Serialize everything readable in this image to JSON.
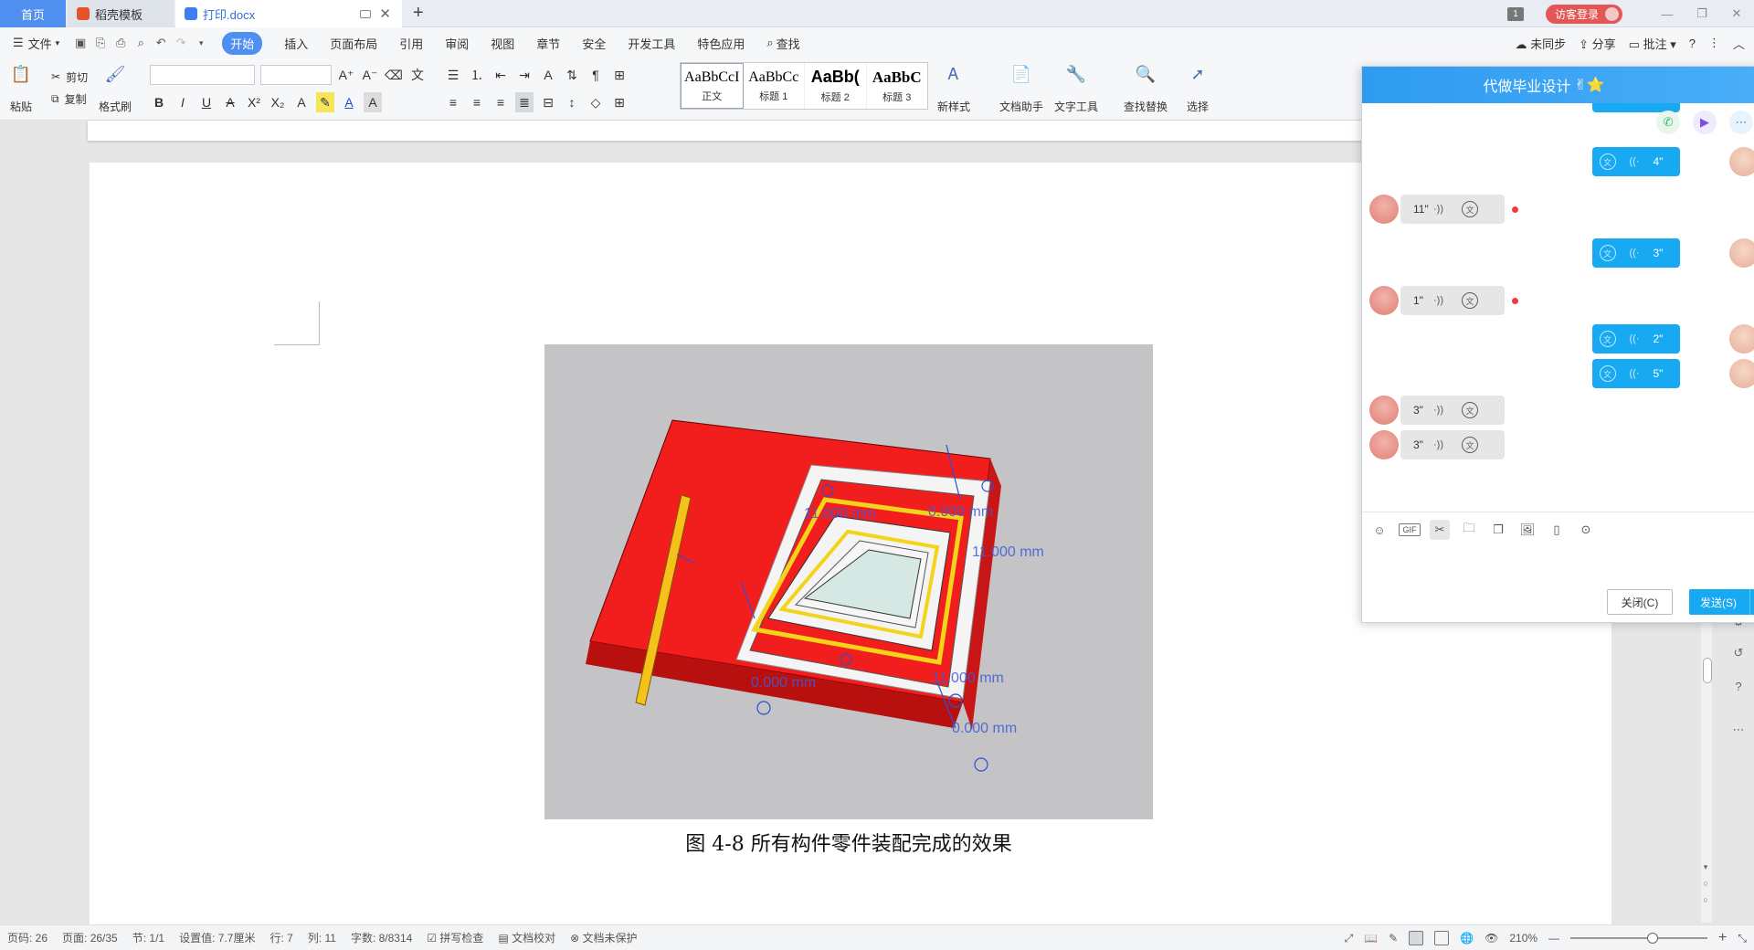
{
  "tabs": {
    "home": "首页",
    "templates": "稻壳模板",
    "doc": "打印.docx"
  },
  "titlebar": {
    "window_count": "1",
    "login": "访客登录"
  },
  "menu": {
    "file": "文件",
    "items": [
      "开始",
      "插入",
      "页面布局",
      "引用",
      "审阅",
      "视图",
      "章节",
      "安全",
      "开发工具",
      "特色应用"
    ],
    "search": "查找",
    "right": [
      "未同步",
      "分享",
      "批注"
    ]
  },
  "ribbon": {
    "paste": "粘贴",
    "cut": "剪切",
    "copy": "复制",
    "format_painter": "格式刷",
    "styles": [
      {
        "preview": "AaBbCcI",
        "name": "正文"
      },
      {
        "preview": "AaBbCc",
        "name": "标题 1"
      },
      {
        "preview": "AaBb(",
        "name": "标题 2"
      },
      {
        "preview": "AaBbC",
        "name": "标题 3"
      }
    ],
    "new_style": "新样式",
    "doc_assistant": "文档助手",
    "text_tools": "文字工具",
    "find_replace": "查找替换",
    "select": "选择"
  },
  "document": {
    "caption": "图 4-8 所有构件零件装配完成的效果",
    "figure_dims": [
      "11.000 mm",
      "0.000 mm",
      "11.000 mm",
      "0.000 mm",
      "11.000 mm",
      "0.000 mm"
    ]
  },
  "statusbar": {
    "page_code": "页码: 26",
    "pages": "页面: 26/35",
    "section": "节: 1/1",
    "setting": "设置值: 7.7厘米",
    "row": "行: 7",
    "col": "列: 11",
    "words": "字数: 8/8314",
    "spell": "拼写检查",
    "proof": "文档校对",
    "protect": "文档未保护",
    "zoom": "210%",
    "zoom_level": 0.6
  },
  "chat": {
    "title": "代做毕业设计",
    "messages": [
      {
        "dir": "out",
        "dur": "4\""
      },
      {
        "dir": "in",
        "dur": "11\""
      },
      {
        "dir": "out",
        "dur": "3\""
      },
      {
        "dir": "in",
        "dur": "1\""
      },
      {
        "dir": "out",
        "dur": "2\""
      },
      {
        "dir": "out",
        "dur": "5\""
      },
      {
        "dir": "in",
        "dur": "3\""
      },
      {
        "dir": "in",
        "dur": "3\""
      }
    ],
    "close": "关闭(C)",
    "send": "发送(S)",
    "gif": "GIF"
  },
  "colors": {
    "accent": "#4f8ff0",
    "chat_blue": "#17a9f1",
    "login_red": "#e35656",
    "model_red": "#f01a1a",
    "model_yellow": "#f0d21a"
  }
}
